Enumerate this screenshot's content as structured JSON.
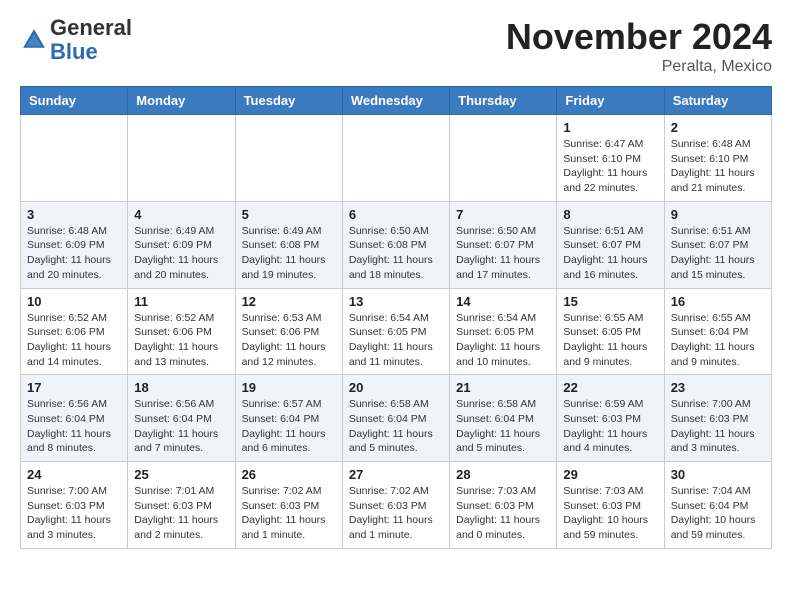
{
  "header": {
    "logo_general": "General",
    "logo_blue": "Blue",
    "month": "November 2024",
    "location": "Peralta, Mexico"
  },
  "weekdays": [
    "Sunday",
    "Monday",
    "Tuesday",
    "Wednesday",
    "Thursday",
    "Friday",
    "Saturday"
  ],
  "weeks": [
    [
      {
        "day": "",
        "info": ""
      },
      {
        "day": "",
        "info": ""
      },
      {
        "day": "",
        "info": ""
      },
      {
        "day": "",
        "info": ""
      },
      {
        "day": "",
        "info": ""
      },
      {
        "day": "1",
        "info": "Sunrise: 6:47 AM\nSunset: 6:10 PM\nDaylight: 11 hours and 22 minutes."
      },
      {
        "day": "2",
        "info": "Sunrise: 6:48 AM\nSunset: 6:10 PM\nDaylight: 11 hours and 21 minutes."
      }
    ],
    [
      {
        "day": "3",
        "info": "Sunrise: 6:48 AM\nSunset: 6:09 PM\nDaylight: 11 hours and 20 minutes."
      },
      {
        "day": "4",
        "info": "Sunrise: 6:49 AM\nSunset: 6:09 PM\nDaylight: 11 hours and 20 minutes."
      },
      {
        "day": "5",
        "info": "Sunrise: 6:49 AM\nSunset: 6:08 PM\nDaylight: 11 hours and 19 minutes."
      },
      {
        "day": "6",
        "info": "Sunrise: 6:50 AM\nSunset: 6:08 PM\nDaylight: 11 hours and 18 minutes."
      },
      {
        "day": "7",
        "info": "Sunrise: 6:50 AM\nSunset: 6:07 PM\nDaylight: 11 hours and 17 minutes."
      },
      {
        "day": "8",
        "info": "Sunrise: 6:51 AM\nSunset: 6:07 PM\nDaylight: 11 hours and 16 minutes."
      },
      {
        "day": "9",
        "info": "Sunrise: 6:51 AM\nSunset: 6:07 PM\nDaylight: 11 hours and 15 minutes."
      }
    ],
    [
      {
        "day": "10",
        "info": "Sunrise: 6:52 AM\nSunset: 6:06 PM\nDaylight: 11 hours and 14 minutes."
      },
      {
        "day": "11",
        "info": "Sunrise: 6:52 AM\nSunset: 6:06 PM\nDaylight: 11 hours and 13 minutes."
      },
      {
        "day": "12",
        "info": "Sunrise: 6:53 AM\nSunset: 6:06 PM\nDaylight: 11 hours and 12 minutes."
      },
      {
        "day": "13",
        "info": "Sunrise: 6:54 AM\nSunset: 6:05 PM\nDaylight: 11 hours and 11 minutes."
      },
      {
        "day": "14",
        "info": "Sunrise: 6:54 AM\nSunset: 6:05 PM\nDaylight: 11 hours and 10 minutes."
      },
      {
        "day": "15",
        "info": "Sunrise: 6:55 AM\nSunset: 6:05 PM\nDaylight: 11 hours and 9 minutes."
      },
      {
        "day": "16",
        "info": "Sunrise: 6:55 AM\nSunset: 6:04 PM\nDaylight: 11 hours and 9 minutes."
      }
    ],
    [
      {
        "day": "17",
        "info": "Sunrise: 6:56 AM\nSunset: 6:04 PM\nDaylight: 11 hours and 8 minutes."
      },
      {
        "day": "18",
        "info": "Sunrise: 6:56 AM\nSunset: 6:04 PM\nDaylight: 11 hours and 7 minutes."
      },
      {
        "day": "19",
        "info": "Sunrise: 6:57 AM\nSunset: 6:04 PM\nDaylight: 11 hours and 6 minutes."
      },
      {
        "day": "20",
        "info": "Sunrise: 6:58 AM\nSunset: 6:04 PM\nDaylight: 11 hours and 5 minutes."
      },
      {
        "day": "21",
        "info": "Sunrise: 6:58 AM\nSunset: 6:04 PM\nDaylight: 11 hours and 5 minutes."
      },
      {
        "day": "22",
        "info": "Sunrise: 6:59 AM\nSunset: 6:03 PM\nDaylight: 11 hours and 4 minutes."
      },
      {
        "day": "23",
        "info": "Sunrise: 7:00 AM\nSunset: 6:03 PM\nDaylight: 11 hours and 3 minutes."
      }
    ],
    [
      {
        "day": "24",
        "info": "Sunrise: 7:00 AM\nSunset: 6:03 PM\nDaylight: 11 hours and 3 minutes."
      },
      {
        "day": "25",
        "info": "Sunrise: 7:01 AM\nSunset: 6:03 PM\nDaylight: 11 hours and 2 minutes."
      },
      {
        "day": "26",
        "info": "Sunrise: 7:02 AM\nSunset: 6:03 PM\nDaylight: 11 hours and 1 minute."
      },
      {
        "day": "27",
        "info": "Sunrise: 7:02 AM\nSunset: 6:03 PM\nDaylight: 11 hours and 1 minute."
      },
      {
        "day": "28",
        "info": "Sunrise: 7:03 AM\nSunset: 6:03 PM\nDaylight: 11 hours and 0 minutes."
      },
      {
        "day": "29",
        "info": "Sunrise: 7:03 AM\nSunset: 6:03 PM\nDaylight: 10 hours and 59 minutes."
      },
      {
        "day": "30",
        "info": "Sunrise: 7:04 AM\nSunset: 6:04 PM\nDaylight: 10 hours and 59 minutes."
      }
    ]
  ]
}
